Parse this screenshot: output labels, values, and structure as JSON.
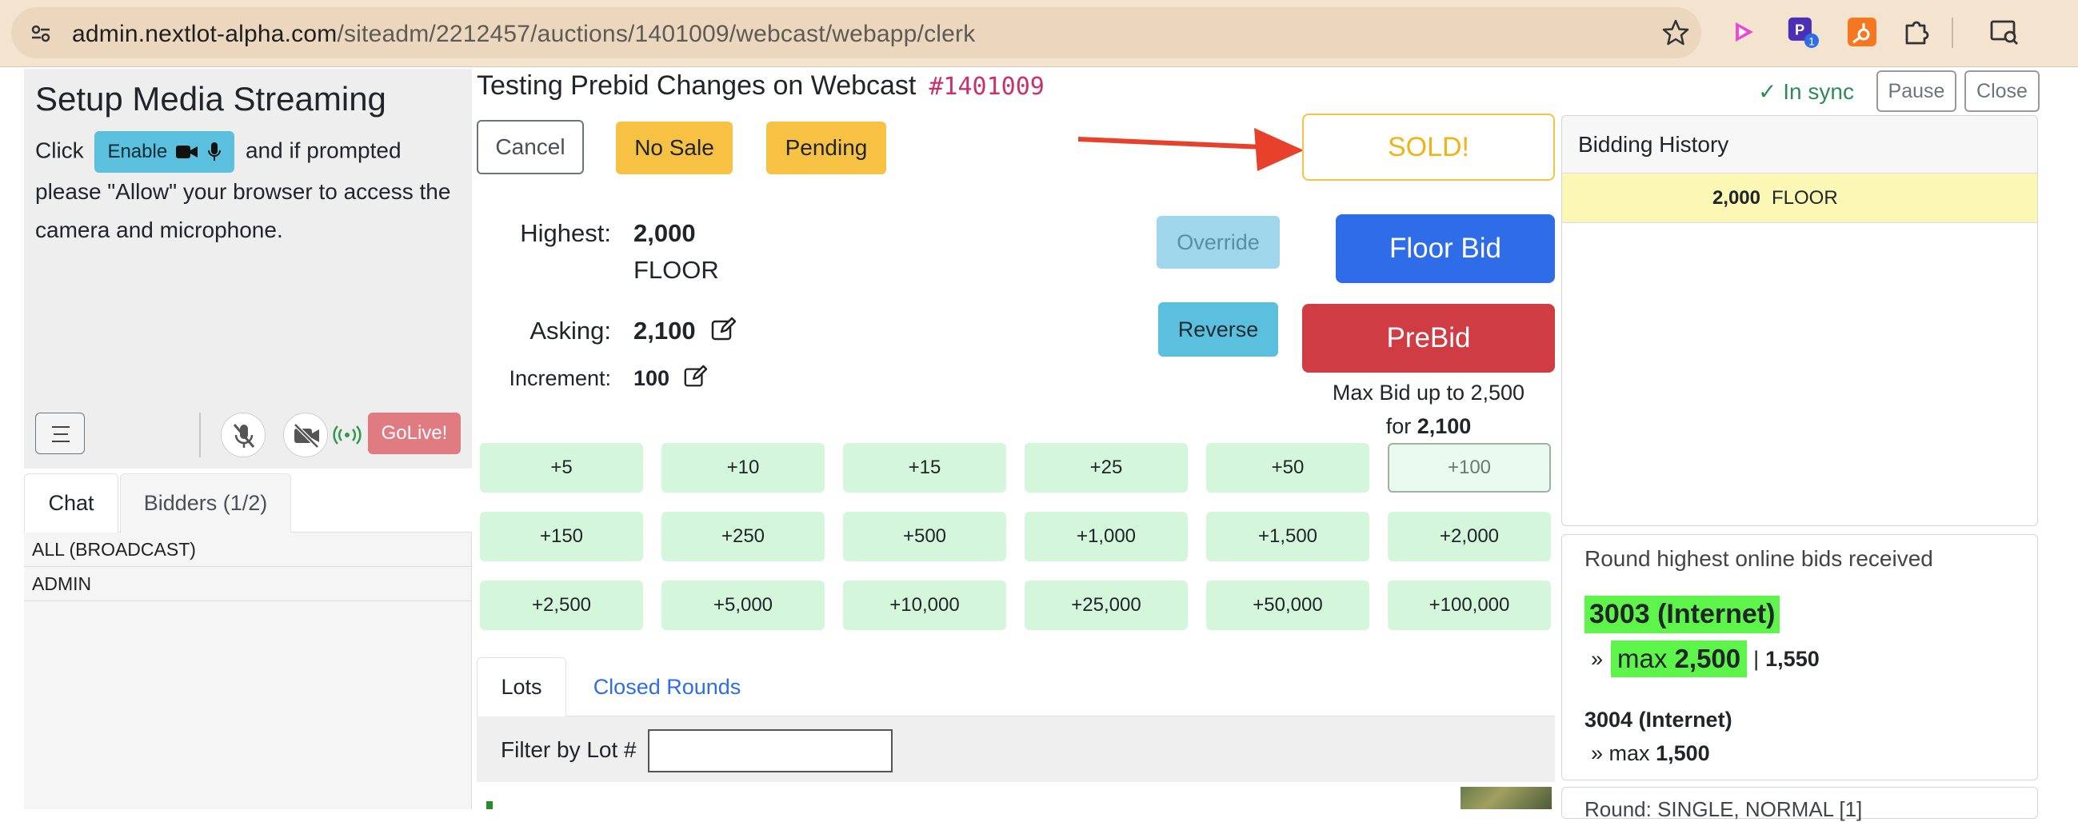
{
  "browser": {
    "url_host": "admin.nextlot-alpha.com",
    "url_path": "/siteadm/2212457/auctions/1401009/webcast/webapp/clerk",
    "extension_badge": "1"
  },
  "setup": {
    "title": "Setup Media Streaming",
    "desc_before": "Click",
    "enable_label": "Enable",
    "desc_after": "and if prompted please \"Allow\" your browser to access the camera and microphone.",
    "golive_label": "GoLive!"
  },
  "left_tabs": {
    "chat": "Chat",
    "bidders": "Bidders (1/2)"
  },
  "chat_list": [
    "ALL (BROADCAST)",
    "ADMIN"
  ],
  "auction": {
    "title": "Testing Prebid Changes on Webcast",
    "id": "#1401009"
  },
  "actions": {
    "cancel": "Cancel",
    "no_sale": "No Sale",
    "pending": "Pending",
    "sold": "SOLD!",
    "override": "Override",
    "reverse": "Reverse",
    "floor_bid": "Floor Bid",
    "prebid": "PreBid"
  },
  "bid_info": {
    "highest_label": "Highest:",
    "highest_value": "2,000",
    "highest_by": "FLOOR",
    "asking_label": "Asking:",
    "asking_value": "2,100",
    "increment_label": "Increment:",
    "increment_value": "100"
  },
  "maxbid": {
    "line1": "Max Bid up to 2,500",
    "line2_prefix": "for",
    "line2_value": "2,100"
  },
  "increments": [
    "+5",
    "+10",
    "+15",
    "+25",
    "+50",
    "+100",
    "+150",
    "+250",
    "+500",
    "+1,000",
    "+1,500",
    "+2,000",
    "+2,500",
    "+5,000",
    "+10,000",
    "+25,000",
    "+50,000",
    "+100,000"
  ],
  "mid_tabs": {
    "lots": "Lots",
    "closed_rounds": "Closed Rounds"
  },
  "filter": {
    "label": "Filter by Lot #",
    "value": ""
  },
  "sync": {
    "status": "✓ In sync",
    "pause": "Pause",
    "close": "Close"
  },
  "history": {
    "title": "Bidding History",
    "rows": [
      {
        "amount": "2,000",
        "bidder": "FLOOR"
      }
    ]
  },
  "online_bids": {
    "title": "Round highest online bids received",
    "bid1_name": "3003 (Internet)",
    "bid1_max_prefix": "max",
    "bid1_max_value": "2,500",
    "bid1_sep": "|",
    "bid1_current": "1,550",
    "bid2_name": "3004 (Internet)",
    "bid2_max_prefix": "max",
    "bid2_max_value": "1,500"
  },
  "bottom_card_text": "Round: SINGLE, NORMAL [1]",
  "colors": {
    "accent_blue": "#2f6de8",
    "danger_red": "#cf3c43",
    "warning_yellow": "#f7c244",
    "success_green": "#2e8b57",
    "highlight_green": "#5ef54b",
    "arrow_red": "#e8412b"
  }
}
